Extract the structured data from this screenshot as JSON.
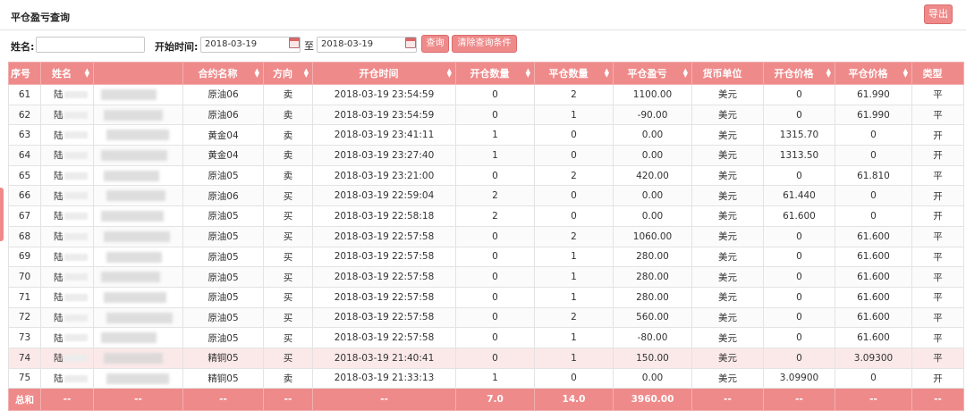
{
  "header": {
    "title": "平仓盈亏查询",
    "export_label": "导出"
  },
  "filters": {
    "name_label": "姓名:",
    "name_value": "",
    "start_time_label": "开始时间:",
    "start_date": "2018-03-19",
    "to_label": "至",
    "end_date": "2018-03-19",
    "query_label": "查询",
    "clear_label": "清除查询条件"
  },
  "table": {
    "columns": [
      "序号",
      "姓名",
      "",
      "合约名称",
      "方向",
      "开仓时间",
      "开仓数量",
      "平仓数量",
      "平仓盈亏",
      "货币单位",
      "开仓价格",
      "平仓价格",
      "类型"
    ],
    "rows": [
      {
        "seq": "61",
        "name": "陆",
        "contract": "原油06",
        "direction": "卖",
        "time": "2018-03-19  23:54:59",
        "open_qty": "0",
        "close_qty": "2",
        "pnl": "1100.00",
        "currency": "美元",
        "open_price": "0",
        "close_price": "61.990",
        "type": "平"
      },
      {
        "seq": "62",
        "name": "陆",
        "contract": "原油06",
        "direction": "卖",
        "time": "2018-03-19  23:54:59",
        "open_qty": "0",
        "close_qty": "1",
        "pnl": "-90.00",
        "currency": "美元",
        "open_price": "0",
        "close_price": "61.990",
        "type": "平"
      },
      {
        "seq": "63",
        "name": "陆",
        "contract": "黄金04",
        "direction": "卖",
        "time": "2018-03-19  23:41:11",
        "open_qty": "1",
        "close_qty": "0",
        "pnl": "0.00",
        "currency": "美元",
        "open_price": "1315.70",
        "close_price": "0",
        "type": "开"
      },
      {
        "seq": "64",
        "name": "陆",
        "contract": "黄金04",
        "direction": "卖",
        "time": "2018-03-19  23:27:40",
        "open_qty": "1",
        "close_qty": "0",
        "pnl": "0.00",
        "currency": "美元",
        "open_price": "1313.50",
        "close_price": "0",
        "type": "开"
      },
      {
        "seq": "65",
        "name": "陆",
        "contract": "原油05",
        "direction": "卖",
        "time": "2018-03-19  23:21:00",
        "open_qty": "0",
        "close_qty": "2",
        "pnl": "420.00",
        "currency": "美元",
        "open_price": "0",
        "close_price": "61.810",
        "type": "平"
      },
      {
        "seq": "66",
        "name": "陆",
        "contract": "原油06",
        "direction": "买",
        "time": "2018-03-19  22:59:04",
        "open_qty": "2",
        "close_qty": "0",
        "pnl": "0.00",
        "currency": "美元",
        "open_price": "61.440",
        "close_price": "0",
        "type": "开"
      },
      {
        "seq": "67",
        "name": "陆",
        "contract": "原油05",
        "direction": "买",
        "time": "2018-03-19  22:58:18",
        "open_qty": "2",
        "close_qty": "0",
        "pnl": "0.00",
        "currency": "美元",
        "open_price": "61.600",
        "close_price": "0",
        "type": "开"
      },
      {
        "seq": "68",
        "name": "陆",
        "contract": "原油05",
        "direction": "买",
        "time": "2018-03-19  22:57:58",
        "open_qty": "0",
        "close_qty": "2",
        "pnl": "1060.00",
        "currency": "美元",
        "open_price": "0",
        "close_price": "61.600",
        "type": "平"
      },
      {
        "seq": "69",
        "name": "陆",
        "contract": "原油05",
        "direction": "买",
        "time": "2018-03-19  22:57:58",
        "open_qty": "0",
        "close_qty": "1",
        "pnl": "280.00",
        "currency": "美元",
        "open_price": "0",
        "close_price": "61.600",
        "type": "平"
      },
      {
        "seq": "70",
        "name": "陆",
        "contract": "原油05",
        "direction": "买",
        "time": "2018-03-19  22:57:58",
        "open_qty": "0",
        "close_qty": "1",
        "pnl": "280.00",
        "currency": "美元",
        "open_price": "0",
        "close_price": "61.600",
        "type": "平"
      },
      {
        "seq": "71",
        "name": "陆",
        "contract": "原油05",
        "direction": "买",
        "time": "2018-03-19  22:57:58",
        "open_qty": "0",
        "close_qty": "1",
        "pnl": "280.00",
        "currency": "美元",
        "open_price": "0",
        "close_price": "61.600",
        "type": "平"
      },
      {
        "seq": "72",
        "name": "陆",
        "contract": "原油05",
        "direction": "买",
        "time": "2018-03-19  22:57:58",
        "open_qty": "0",
        "close_qty": "2",
        "pnl": "560.00",
        "currency": "美元",
        "open_price": "0",
        "close_price": "61.600",
        "type": "平"
      },
      {
        "seq": "73",
        "name": "陆",
        "contract": "原油05",
        "direction": "买",
        "time": "2018-03-19  22:57:58",
        "open_qty": "0",
        "close_qty": "1",
        "pnl": "-80.00",
        "currency": "美元",
        "open_price": "0",
        "close_price": "61.600",
        "type": "平"
      },
      {
        "seq": "74",
        "name": "陆",
        "contract": "精铜05",
        "direction": "买",
        "time": "2018-03-19  21:40:41",
        "open_qty": "0",
        "close_qty": "1",
        "pnl": "150.00",
        "currency": "美元",
        "open_price": "0",
        "close_price": "3.09300",
        "type": "平"
      },
      {
        "seq": "75",
        "name": "陆",
        "contract": "精铜05",
        "direction": "卖",
        "time": "2018-03-19  21:33:13",
        "open_qty": "1",
        "close_qty": "0",
        "pnl": "0.00",
        "currency": "美元",
        "open_price": "3.09900",
        "close_price": "0",
        "type": "开"
      }
    ],
    "totals": [
      "总和",
      "--",
      "--",
      "--",
      "--",
      "--",
      "7.0",
      "14.0",
      "3960.00",
      "--",
      "--",
      "--",
      "--"
    ]
  },
  "icons": {
    "calendar": "calendar-icon",
    "sort": "sort-icon"
  },
  "colors": {
    "accent": "#ef8a8a",
    "accent_border": "#d96c6c",
    "highlight_row": "#fbe9e9"
  }
}
